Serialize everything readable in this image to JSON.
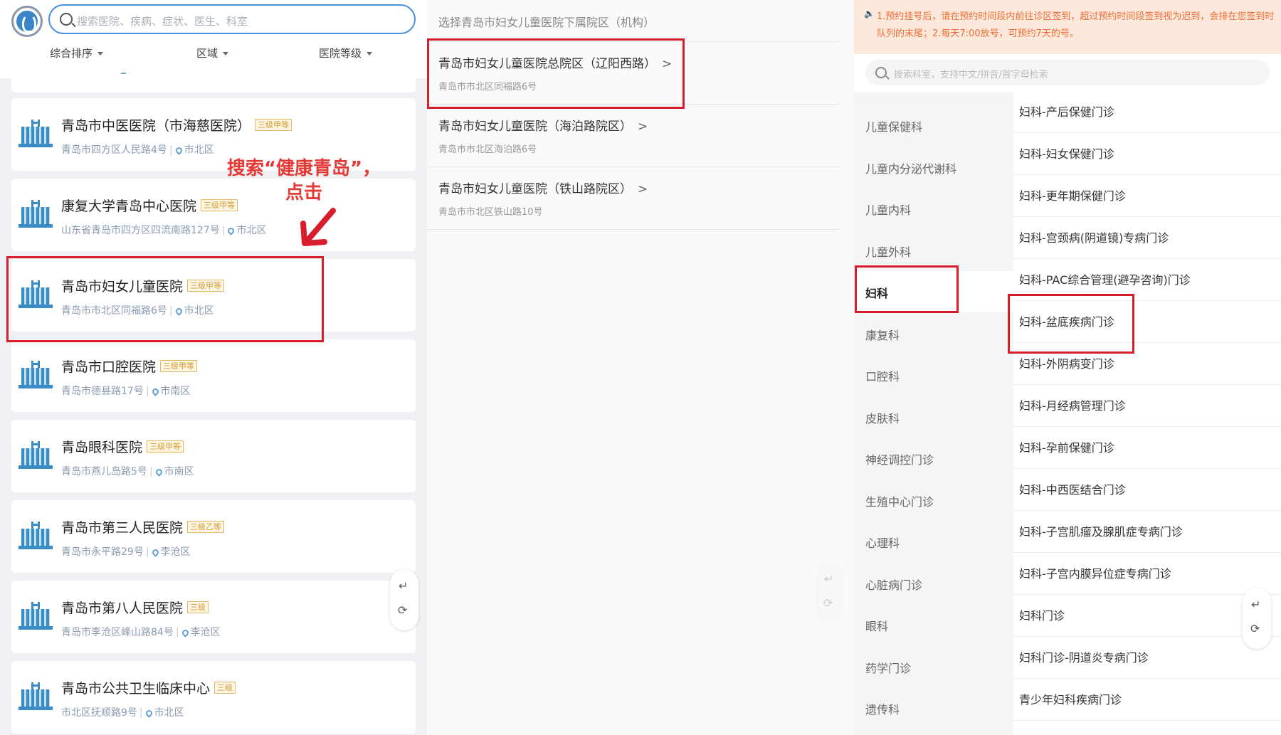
{
  "panel1": {
    "search_placeholder": "搜索医院、疾病、症状、医生、科室",
    "filters": [
      "综合排序",
      "区域",
      "医院等级"
    ],
    "annotation_line1": "搜索“健康青岛”，",
    "annotation_line2": "点击",
    "hospitals": [
      {
        "name": "青岛市中医医院（市海慈医院）",
        "level": "三级甲等",
        "address": "青岛市四方区人民路4号",
        "district": "市北区"
      },
      {
        "name": "康复大学青岛中心医院",
        "level": "三级甲等",
        "address": "山东省青岛市四方区四流南路127号",
        "district": "市北区"
      },
      {
        "name": "青岛市妇女儿童医院",
        "level": "三级甲等",
        "address": "青岛市市北区同福路6号",
        "district": "市北区"
      },
      {
        "name": "青岛市口腔医院",
        "level": "三级甲等",
        "address": "青岛市德县路17号",
        "district": "市南区"
      },
      {
        "name": "青岛眼科医院",
        "level": "三级甲等",
        "address": "青岛市燕儿岛路5号",
        "district": "市南区"
      },
      {
        "name": "青岛市第三人民医院",
        "level": "三级乙等",
        "address": "青岛市永平路29号",
        "district": "李沧区"
      },
      {
        "name": "青岛市第八人民医院",
        "level": "三级",
        "address": "青岛市李沧区峰山路84号",
        "district": "李沧区"
      },
      {
        "name": "青岛市公共卫生临床中心",
        "level": "三级",
        "address": "市北区抚顺路9号",
        "district": "市北区"
      }
    ],
    "fab": {
      "return_icon": "↵",
      "refresh_icon": "⟳"
    }
  },
  "panel2": {
    "header": "选择青岛市妇女儿童医院下属院区（机构）",
    "branches": [
      {
        "name": "青岛市妇女儿童医院总院区（辽阳西路）",
        "address": "青岛市市北区同福路6号"
      },
      {
        "name": "青岛市妇女儿童医院（海泊路院区）",
        "address": "青岛市市北区海泊路6号"
      },
      {
        "name": "青岛市妇女儿童医院（铁山路院区）",
        "address": "青岛市市北区铁山路10号"
      }
    ],
    "arrow": ">",
    "fab": {
      "return_icon": "↵",
      "refresh_icon": "⟳"
    }
  },
  "panel3": {
    "notice_icon": "🔈",
    "notice": "1.预约挂号后，请在预约时间段内前往诊区签到，超过预约时间段签到视为迟到，会排在您签到时队列的末尾；2.每天7:00放号，可预约7天的号。",
    "search_placeholder": "搜索科室，支持中文/拼音/首字母检索",
    "departments": [
      "儿童保健科",
      "儿童内分泌代谢科",
      "儿童内科",
      "儿童外科",
      "妇科",
      "康复科",
      "口腔科",
      "皮肤科",
      "神经调控门诊",
      "生殖中心门诊",
      "心理科",
      "心脏病门诊",
      "眼科",
      "药学门诊",
      "遗传科"
    ],
    "active_department": "妇科",
    "clinics": [
      "妇科-产后保健门诊",
      "妇科-妇女保健门诊",
      "妇科-更年期保健门诊",
      "妇科-宫颈病(阴道镜)专病门诊",
      "妇科-PAC综合管理(避孕咨询)门诊",
      "妇科-盆底疾病门诊",
      "妇科-外阴病变门诊",
      "妇科-月经病管理门诊",
      "妇科-孕前保健门诊",
      "妇科-中西医结合门诊",
      "妇科-子宫肌瘤及腺肌症专病门诊",
      "妇科-子宫内膜异位症专病门诊",
      "妇科门诊",
      "妇科门诊-阴道炎专病门诊",
      "青少年妇科疾病门诊"
    ],
    "fab": {
      "return_icon": "↵",
      "refresh_icon": "⟳"
    }
  },
  "colors": {
    "highlight": "#d81e2c",
    "accent": "#4a90e2",
    "notice_text": "#ef6d33",
    "badge": "#d19b3a"
  }
}
